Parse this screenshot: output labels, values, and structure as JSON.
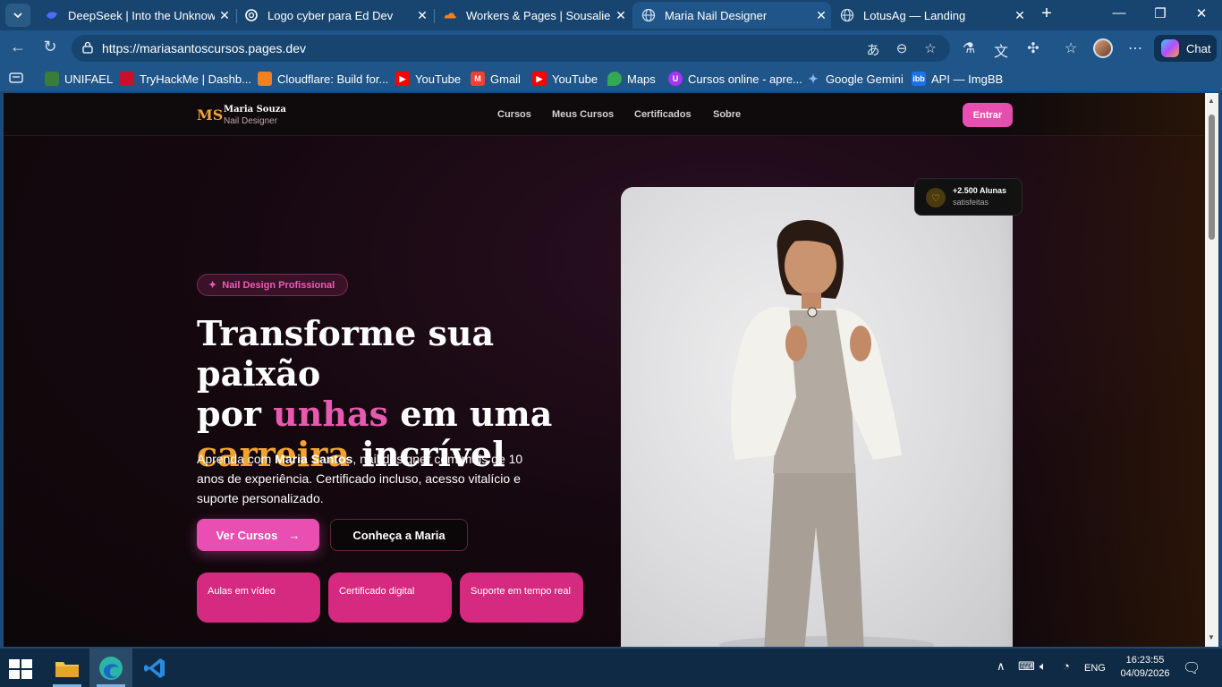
{
  "browser": {
    "tabs": [
      {
        "title": "DeepSeek | Into the Unknown",
        "active": false,
        "color": "#4d6bfe"
      },
      {
        "title": "Logo cyber para Ed Dev",
        "active": false,
        "color": "#ffffff"
      },
      {
        "title": "Workers & Pages | Sousaliedsc",
        "active": false,
        "color": "#f38020"
      },
      {
        "title": "Maria Nail Designer",
        "active": true,
        "color": "#cfe0f0"
      },
      {
        "title": "LotusAg — Landing",
        "active": false,
        "color": "#cfe0f0"
      }
    ],
    "url": "https://mariasantoscursos.pages.dev",
    "chat_label": "Chat",
    "bookmarks": [
      {
        "label": "UNIFAEL",
        "color": "#3a7d3a"
      },
      {
        "label": "TryHackMe | Dashb...",
        "color": "#c8102e"
      },
      {
        "label": "Cloudflare: Build for...",
        "color": "#f38020"
      },
      {
        "label": "YouTube",
        "color": "#ff0000"
      },
      {
        "label": "Gmail",
        "color": "#ea4335"
      },
      {
        "label": "YouTube",
        "color": "#ff0000"
      },
      {
        "label": "Maps",
        "color": "#34a853"
      },
      {
        "label": "Cursos online - apre...",
        "color": "#a435f0"
      },
      {
        "label": "Google Gemini",
        "color": "#4285f4"
      },
      {
        "label": "API — ImgBB",
        "color": "#1a73e8"
      }
    ]
  },
  "site": {
    "logo": "MS",
    "brand_name": "Maria Souza",
    "brand_sub": "Nail Designer",
    "nav": [
      "Cursos",
      "Meus Cursos",
      "Certificados",
      "Sobre"
    ],
    "login_label": "Entrar",
    "badge": "Nail Design Profissional",
    "title": {
      "line1": "Transforme sua paixão",
      "line2_pre": "por ",
      "line2_pink": "unhas",
      "line2_post": " em uma",
      "line3_gold": "carreira",
      "line3_post": " incrível"
    },
    "description": {
      "pre": "Aprenda com ",
      "name": "Maria Santos",
      "post": ", nail designer com mais de 10 anos de experiência. Certificado incluso, acesso vitalício e suporte personalizado."
    },
    "primary_cta": "Ver Cursos",
    "secondary_cta": "Conheça a Maria",
    "features": [
      "Aulas em vídeo",
      "Certificado digital",
      "Suporte em tempo real"
    ],
    "stats": {
      "count": "+2.500 Alunas",
      "label": "satisfeitas"
    },
    "colors": {
      "accent_pink": "#e84fb0",
      "accent_gold": "#f0a330",
      "feature_bg": "#d52a80"
    }
  },
  "taskbar": {
    "language": "ENG",
    "time": "16:23:55",
    "date": "04/09/2026"
  }
}
